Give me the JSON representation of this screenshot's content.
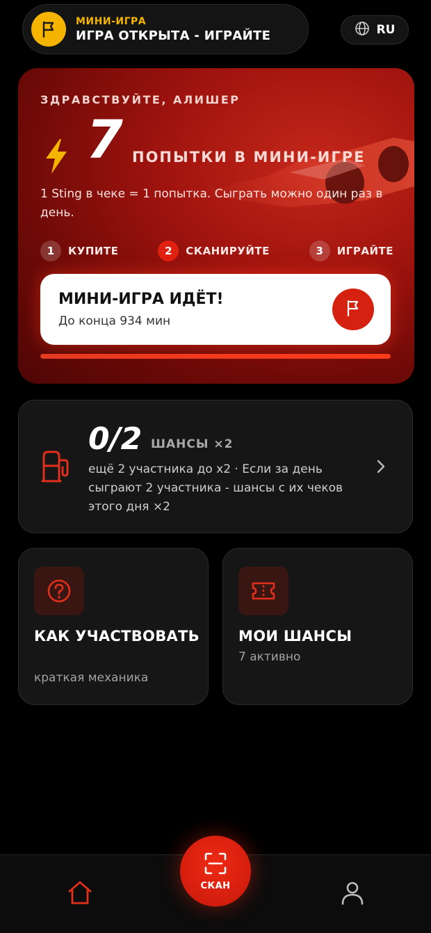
{
  "header": {
    "kicker": "МИНИ-ИГРА",
    "status": "ИГРА ОТКРЫТА - ИГРАЙТЕ",
    "language": "RU"
  },
  "hero": {
    "greeting": "ЗДРАВСТВУЙТЕ, АЛИШЕР",
    "attempts_count": "7",
    "attempts_label": "ПОПЫТКИ В МИНИ-ИГРЕ",
    "rule": "1 Sting в чеке = 1 попытка. Сыграть можно один раз в день.",
    "steps": [
      {
        "num": "1",
        "label": "КУПИТЕ"
      },
      {
        "num": "2",
        "label": "СКАНИРУЙТЕ"
      },
      {
        "num": "3",
        "label": "ИГРАЙТЕ"
      }
    ],
    "active_step": 2,
    "game": {
      "title": "МИНИ-ИГРА ИДЁТ!",
      "subtitle": "До конца 934 мин"
    },
    "progress_fraction": 1.0
  },
  "chances": {
    "ratio": "0/2",
    "label": "ШАНСЫ ×2",
    "description": "ещё 2 участника до x2 · Если за день сыграют 2 участника - шансы с их чеков этого дня ×2"
  },
  "tiles": [
    {
      "title": "КАК УЧАСТВОВАТЬ",
      "subtitle": "краткая механика",
      "icon": "question-icon"
    },
    {
      "title": "МОИ ШАНСЫ",
      "subtitle": "7 активно",
      "icon": "ticket-icon"
    }
  ],
  "nav": {
    "scan_label": "СКАН"
  },
  "colors": {
    "accent": "#f5b400",
    "brand_red": "#d52210",
    "background": "#000000"
  }
}
